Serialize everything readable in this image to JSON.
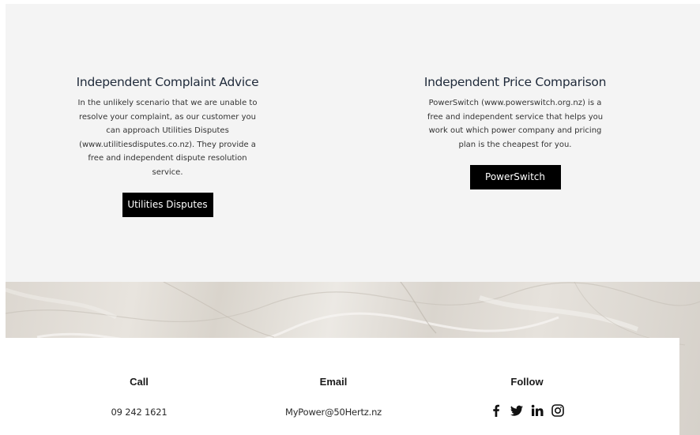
{
  "complaint": {
    "title": "Independent Complaint Advice",
    "text": "In the unlikely scenario that we are unable to resolve your complaint, as our customer you can approach Utilities Disputes (www.utilitiesdisputes.co.nz). They provide a free and independent dispute resolution service.",
    "button_label": "Utilities Disputes"
  },
  "comparison": {
    "title": "Independent Price Comparison",
    "text": "PowerSwitch (www.powerswitch.org.nz) is a free and independent service that helps you work out which power company and pricing plan is the cheapest for you.",
    "button_label": "PowerSwitch"
  },
  "footer": {
    "call": {
      "heading": "Call",
      "value": "09 242 1621"
    },
    "email": {
      "heading": "Email",
      "value": "MyPower@50Hertz.nz"
    },
    "follow": {
      "heading": "Follow",
      "icons": [
        "facebook-icon",
        "twitter-icon",
        "linkedin-icon",
        "instagram-icon"
      ]
    }
  },
  "colors": {
    "section_bg": "#f4f4f4",
    "button_bg": "#000000",
    "button_text": "#ffffff",
    "title_text": "#1f2a3a"
  }
}
